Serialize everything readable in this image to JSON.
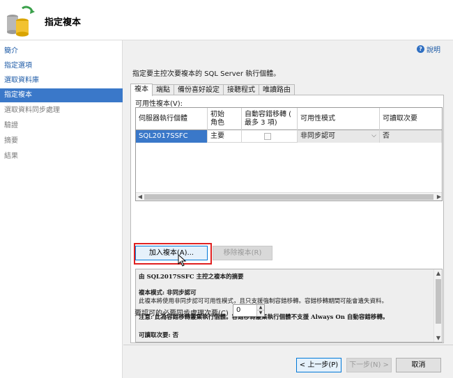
{
  "header": {
    "title": "指定複本"
  },
  "sidebar": {
    "items": [
      {
        "label": "簡介",
        "state": "normal"
      },
      {
        "label": "指定選項",
        "state": "normal"
      },
      {
        "label": "選取資料庫",
        "state": "normal"
      },
      {
        "label": "指定複本",
        "state": "selected"
      },
      {
        "label": "選取資料同步處理",
        "state": "disabled"
      },
      {
        "label": "驗證",
        "state": "disabled"
      },
      {
        "label": "摘要",
        "state": "disabled"
      },
      {
        "label": "結果",
        "state": "disabled"
      }
    ]
  },
  "help": {
    "label": "說明"
  },
  "instruction": "指定要主控次要複本的 SQL Server 執行個體。",
  "tabs": [
    "複本",
    "端點",
    "備份喜好設定",
    "接聽程式",
    "唯讀路由"
  ],
  "available_replicas": {
    "label": "可用性複本(V):",
    "columns": [
      "伺服器執行個體",
      "初始\n角色",
      "自動容錯移轉 (\n最多 3 項)",
      "可用性模式",
      "可讀取次要"
    ],
    "rows": [
      {
        "server": "SQL2017SSFC",
        "role": "主要",
        "auto_failover": false,
        "mode": "非同步認可",
        "readable": "否"
      }
    ]
  },
  "buttons": {
    "add_replica": "加入複本(A)...",
    "remove_replica": "移除複本(R)"
  },
  "summary": {
    "title": "由 SQL2017SSFC 主控之複本的摘要",
    "replica_mode": "複本模式: 非同步認可",
    "replica_mode_desc": "此複本將使用非同步認可可用性模式，且只支援強制容錯移轉。容錯移轉期間可能會遺失資料。",
    "note": "注意: 此為容錯移轉叢集執行個體。容錯移轉叢集執行個體不支援 Always On 自動容錯移轉。",
    "readable_secondary": "可讀取次要: 否"
  },
  "required_sync": {
    "label": "要認可的必要同步處理次要(C)",
    "value": "0"
  },
  "footer": {
    "prev": "< 上一步(P)",
    "next": "下一步(N) >",
    "cancel": "取消"
  }
}
